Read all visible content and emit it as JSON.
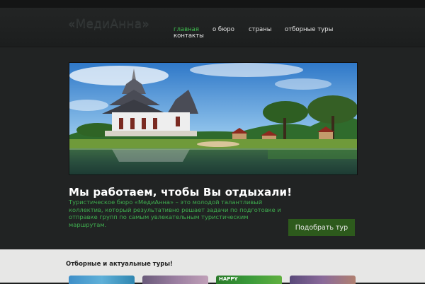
{
  "site": {
    "logo": "«МедиАнна»"
  },
  "nav": {
    "items": [
      "главная",
      "о бюро",
      "страны",
      "отборные туры",
      "контакты"
    ],
    "active_index": 0
  },
  "hero": {
    "image": "thai-temple-lake-photo",
    "headline": "Мы работаем, чтобы Вы отдыхали!",
    "description": "Туристическое бюро «МедиАнна» – это молодой талантливый коллектив, который результативно решает задачи по подготовке и отправке групп по самым увлекательным туристическим маршрутам.",
    "cta_label": "Подобрать тур"
  },
  "tours": {
    "title": "Отборные и актуальные туры!",
    "thumbs": [
      {
        "image": "beach-thumb",
        "caption": ""
      },
      {
        "image": "city-thumb",
        "caption": ""
      },
      {
        "image": "happy-thumb",
        "caption": "HAPPY"
      },
      {
        "image": "temple-thumb",
        "caption": ""
      }
    ]
  },
  "colors": {
    "accent": "#3fbd4f",
    "button": "#2d5a1c",
    "header": "#232525"
  }
}
